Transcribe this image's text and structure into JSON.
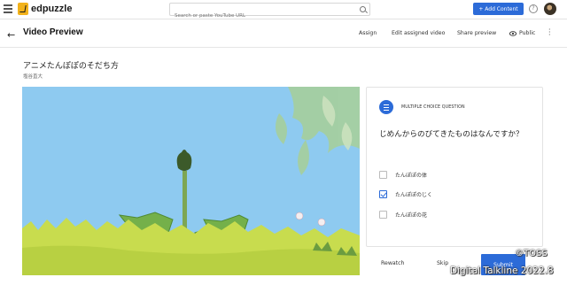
{
  "topbar": {
    "logo_text": "edpuzzle",
    "search_placeholder": "Search or paste YouTube URL",
    "add_content_label": "+ Add Content",
    "help_label": "?"
  },
  "header": {
    "back_icon": "←",
    "title": "Video Preview",
    "assign": "Assign",
    "edit_assigned": "Edit assigned video",
    "share_preview": "Share preview",
    "visibility": "Public"
  },
  "video": {
    "title": "アニメたんぽぽのそだち方",
    "author": "塩谷直大"
  },
  "question": {
    "type": "MULTIPLE CHOICE QUESTION",
    "text": "じめんからのびてきたものはなんですか？",
    "options": [
      {
        "label": "たんぽぽの体",
        "checked": false
      },
      {
        "label": "たんぽぽのじく",
        "checked": true
      },
      {
        "label": "たんぽぽの花",
        "checked": false
      }
    ]
  },
  "actions": {
    "rewatch": "Rewatch",
    "skip": "Skip",
    "submit": "Submit"
  },
  "watermark": {
    "line1": "©TOSS",
    "line2": "Digital Talkline 2022.8"
  },
  "colors": {
    "accent": "#2c6bd8",
    "sky": "#8ecaf0",
    "grass": "#c8dc4e"
  }
}
